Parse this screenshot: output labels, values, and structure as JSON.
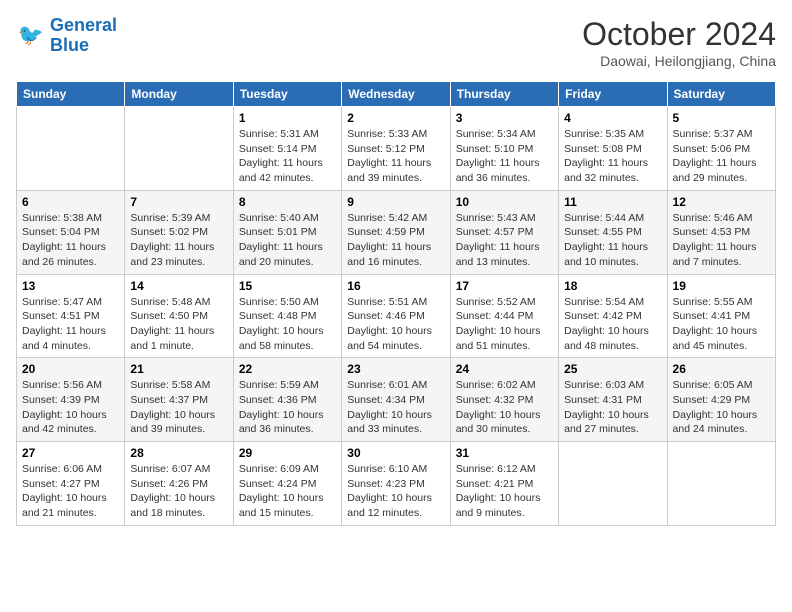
{
  "header": {
    "logo_line1": "General",
    "logo_line2": "Blue",
    "month": "October 2024",
    "location": "Daowai, Heilongjiang, China"
  },
  "days_of_week": [
    "Sunday",
    "Monday",
    "Tuesday",
    "Wednesday",
    "Thursday",
    "Friday",
    "Saturday"
  ],
  "weeks": [
    [
      {
        "day": "",
        "sunrise": "",
        "sunset": "",
        "daylight": ""
      },
      {
        "day": "",
        "sunrise": "",
        "sunset": "",
        "daylight": ""
      },
      {
        "day": "1",
        "sunrise": "Sunrise: 5:31 AM",
        "sunset": "Sunset: 5:14 PM",
        "daylight": "Daylight: 11 hours and 42 minutes."
      },
      {
        "day": "2",
        "sunrise": "Sunrise: 5:33 AM",
        "sunset": "Sunset: 5:12 PM",
        "daylight": "Daylight: 11 hours and 39 minutes."
      },
      {
        "day": "3",
        "sunrise": "Sunrise: 5:34 AM",
        "sunset": "Sunset: 5:10 PM",
        "daylight": "Daylight: 11 hours and 36 minutes."
      },
      {
        "day": "4",
        "sunrise": "Sunrise: 5:35 AM",
        "sunset": "Sunset: 5:08 PM",
        "daylight": "Daylight: 11 hours and 32 minutes."
      },
      {
        "day": "5",
        "sunrise": "Sunrise: 5:37 AM",
        "sunset": "Sunset: 5:06 PM",
        "daylight": "Daylight: 11 hours and 29 minutes."
      }
    ],
    [
      {
        "day": "6",
        "sunrise": "Sunrise: 5:38 AM",
        "sunset": "Sunset: 5:04 PM",
        "daylight": "Daylight: 11 hours and 26 minutes."
      },
      {
        "day": "7",
        "sunrise": "Sunrise: 5:39 AM",
        "sunset": "Sunset: 5:02 PM",
        "daylight": "Daylight: 11 hours and 23 minutes."
      },
      {
        "day": "8",
        "sunrise": "Sunrise: 5:40 AM",
        "sunset": "Sunset: 5:01 PM",
        "daylight": "Daylight: 11 hours and 20 minutes."
      },
      {
        "day": "9",
        "sunrise": "Sunrise: 5:42 AM",
        "sunset": "Sunset: 4:59 PM",
        "daylight": "Daylight: 11 hours and 16 minutes."
      },
      {
        "day": "10",
        "sunrise": "Sunrise: 5:43 AM",
        "sunset": "Sunset: 4:57 PM",
        "daylight": "Daylight: 11 hours and 13 minutes."
      },
      {
        "day": "11",
        "sunrise": "Sunrise: 5:44 AM",
        "sunset": "Sunset: 4:55 PM",
        "daylight": "Daylight: 11 hours and 10 minutes."
      },
      {
        "day": "12",
        "sunrise": "Sunrise: 5:46 AM",
        "sunset": "Sunset: 4:53 PM",
        "daylight": "Daylight: 11 hours and 7 minutes."
      }
    ],
    [
      {
        "day": "13",
        "sunrise": "Sunrise: 5:47 AM",
        "sunset": "Sunset: 4:51 PM",
        "daylight": "Daylight: 11 hours and 4 minutes."
      },
      {
        "day": "14",
        "sunrise": "Sunrise: 5:48 AM",
        "sunset": "Sunset: 4:50 PM",
        "daylight": "Daylight: 11 hours and 1 minute."
      },
      {
        "day": "15",
        "sunrise": "Sunrise: 5:50 AM",
        "sunset": "Sunset: 4:48 PM",
        "daylight": "Daylight: 10 hours and 58 minutes."
      },
      {
        "day": "16",
        "sunrise": "Sunrise: 5:51 AM",
        "sunset": "Sunset: 4:46 PM",
        "daylight": "Daylight: 10 hours and 54 minutes."
      },
      {
        "day": "17",
        "sunrise": "Sunrise: 5:52 AM",
        "sunset": "Sunset: 4:44 PM",
        "daylight": "Daylight: 10 hours and 51 minutes."
      },
      {
        "day": "18",
        "sunrise": "Sunrise: 5:54 AM",
        "sunset": "Sunset: 4:42 PM",
        "daylight": "Daylight: 10 hours and 48 minutes."
      },
      {
        "day": "19",
        "sunrise": "Sunrise: 5:55 AM",
        "sunset": "Sunset: 4:41 PM",
        "daylight": "Daylight: 10 hours and 45 minutes."
      }
    ],
    [
      {
        "day": "20",
        "sunrise": "Sunrise: 5:56 AM",
        "sunset": "Sunset: 4:39 PM",
        "daylight": "Daylight: 10 hours and 42 minutes."
      },
      {
        "day": "21",
        "sunrise": "Sunrise: 5:58 AM",
        "sunset": "Sunset: 4:37 PM",
        "daylight": "Daylight: 10 hours and 39 minutes."
      },
      {
        "day": "22",
        "sunrise": "Sunrise: 5:59 AM",
        "sunset": "Sunset: 4:36 PM",
        "daylight": "Daylight: 10 hours and 36 minutes."
      },
      {
        "day": "23",
        "sunrise": "Sunrise: 6:01 AM",
        "sunset": "Sunset: 4:34 PM",
        "daylight": "Daylight: 10 hours and 33 minutes."
      },
      {
        "day": "24",
        "sunrise": "Sunrise: 6:02 AM",
        "sunset": "Sunset: 4:32 PM",
        "daylight": "Daylight: 10 hours and 30 minutes."
      },
      {
        "day": "25",
        "sunrise": "Sunrise: 6:03 AM",
        "sunset": "Sunset: 4:31 PM",
        "daylight": "Daylight: 10 hours and 27 minutes."
      },
      {
        "day": "26",
        "sunrise": "Sunrise: 6:05 AM",
        "sunset": "Sunset: 4:29 PM",
        "daylight": "Daylight: 10 hours and 24 minutes."
      }
    ],
    [
      {
        "day": "27",
        "sunrise": "Sunrise: 6:06 AM",
        "sunset": "Sunset: 4:27 PM",
        "daylight": "Daylight: 10 hours and 21 minutes."
      },
      {
        "day": "28",
        "sunrise": "Sunrise: 6:07 AM",
        "sunset": "Sunset: 4:26 PM",
        "daylight": "Daylight: 10 hours and 18 minutes."
      },
      {
        "day": "29",
        "sunrise": "Sunrise: 6:09 AM",
        "sunset": "Sunset: 4:24 PM",
        "daylight": "Daylight: 10 hours and 15 minutes."
      },
      {
        "day": "30",
        "sunrise": "Sunrise: 6:10 AM",
        "sunset": "Sunset: 4:23 PM",
        "daylight": "Daylight: 10 hours and 12 minutes."
      },
      {
        "day": "31",
        "sunrise": "Sunrise: 6:12 AM",
        "sunset": "Sunset: 4:21 PM",
        "daylight": "Daylight: 10 hours and 9 minutes."
      },
      {
        "day": "",
        "sunrise": "",
        "sunset": "",
        "daylight": ""
      },
      {
        "day": "",
        "sunrise": "",
        "sunset": "",
        "daylight": ""
      }
    ]
  ]
}
